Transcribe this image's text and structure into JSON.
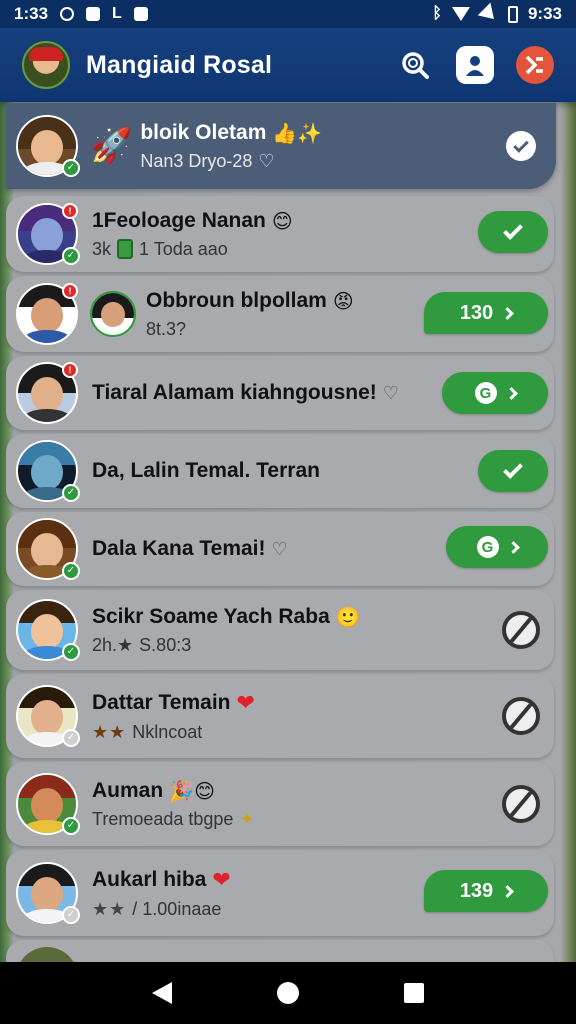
{
  "status_bar": {
    "time_left": "1:33",
    "time_right": "9:33",
    "left_icons": [
      "circle-app-icon",
      "square-app-icon",
      "l-app-icon",
      "notification-app-icon"
    ],
    "right_icons": [
      "bluetooth-icon",
      "wifi-icon",
      "signal-icon",
      "battery-icon"
    ]
  },
  "app_bar": {
    "title": "Mangiaid Rosal",
    "actions": [
      "search-icon",
      "profile-icon",
      "menu-icon"
    ]
  },
  "pinned": {
    "name": "bloik Oletam",
    "sub": "Nan3 Dryo-28",
    "emoji_left": "🚀",
    "emoji_right": "👍✨"
  },
  "list": [
    {
      "name": "1Feoloage Nanan",
      "sub": "3k",
      "sub2": "1 Toda aao",
      "name_emoji": "😊",
      "action": "check",
      "notif": true,
      "status": "online"
    },
    {
      "name": "Obbroun blpollam",
      "sub": "8t.3?",
      "name_emoji": "😡",
      "action": "chat-count",
      "action_label": "130",
      "notif": true,
      "status": "none"
    },
    {
      "name": "Tiaral Alamam kiahngousne!",
      "sub": "",
      "name_emoji": "♡",
      "action": "refresh",
      "notif": true,
      "status": "none"
    },
    {
      "name": "Da, Lalin Temal. Terran",
      "sub": "",
      "name_emoji": "",
      "action": "check",
      "notif": false,
      "status": "online"
    },
    {
      "name": "Dala Kana Temai!",
      "sub": "",
      "name_emoji": "♡",
      "action": "refresh",
      "notif": false,
      "status": "online"
    },
    {
      "name": "Scikr Soame Yach Raba",
      "sub": "2h.★",
      "sub2": "S.80:3",
      "name_emoji": "🙂",
      "action": "blocked",
      "notif": false,
      "status": "online"
    },
    {
      "name": "Dattar Temain",
      "sub": "★★",
      "sub2": "Nklncoat",
      "name_emoji": "❤",
      "action": "blocked",
      "notif": false,
      "status": "grey"
    },
    {
      "name": "Auman",
      "sub": "Tremoeada tbgpe",
      "name_emoji": "🎉😊",
      "action": "blocked",
      "notif": false,
      "status": "online"
    },
    {
      "name": "Aukarl hiba",
      "sub": "★★",
      "sub2": "/ 1.00inaae",
      "name_emoji": "❤",
      "action": "chat-count",
      "action_label": "139",
      "notif": false,
      "status": "grey"
    }
  ]
}
